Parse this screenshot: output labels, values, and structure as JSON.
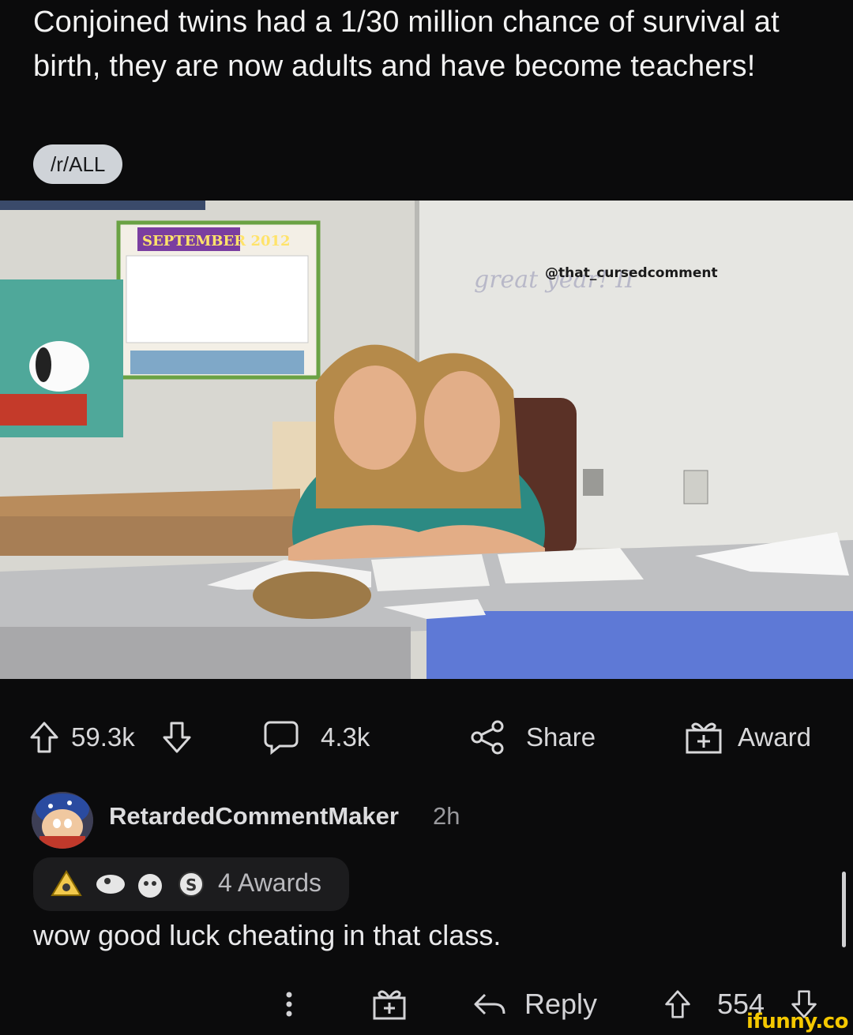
{
  "post": {
    "title": "Conjoined twins had a 1/30 million chance of survival at birth, they are now adults and have become teachers!",
    "subreddit": "/r/ALL"
  },
  "image": {
    "watermark": "@that_cursedcomment",
    "whiteboard_text": "great year! II",
    "calendar_header": "SEPTEMBER 2012"
  },
  "actions": {
    "upvotes": "59.3k",
    "comments": "4.3k",
    "share_label": "Share",
    "award_label": "Award"
  },
  "comment": {
    "author": "RetardedCommentMaker",
    "age": "2h",
    "awards": "4 Awards",
    "body": "wow good luck cheating in that class.",
    "reply_label": "Reply",
    "score": "554"
  },
  "footer": {
    "brand": "ifunny.co"
  },
  "colors": {
    "background": "#0b0b0c",
    "pill": "#cfd3d8",
    "brand": "#f5c800"
  }
}
